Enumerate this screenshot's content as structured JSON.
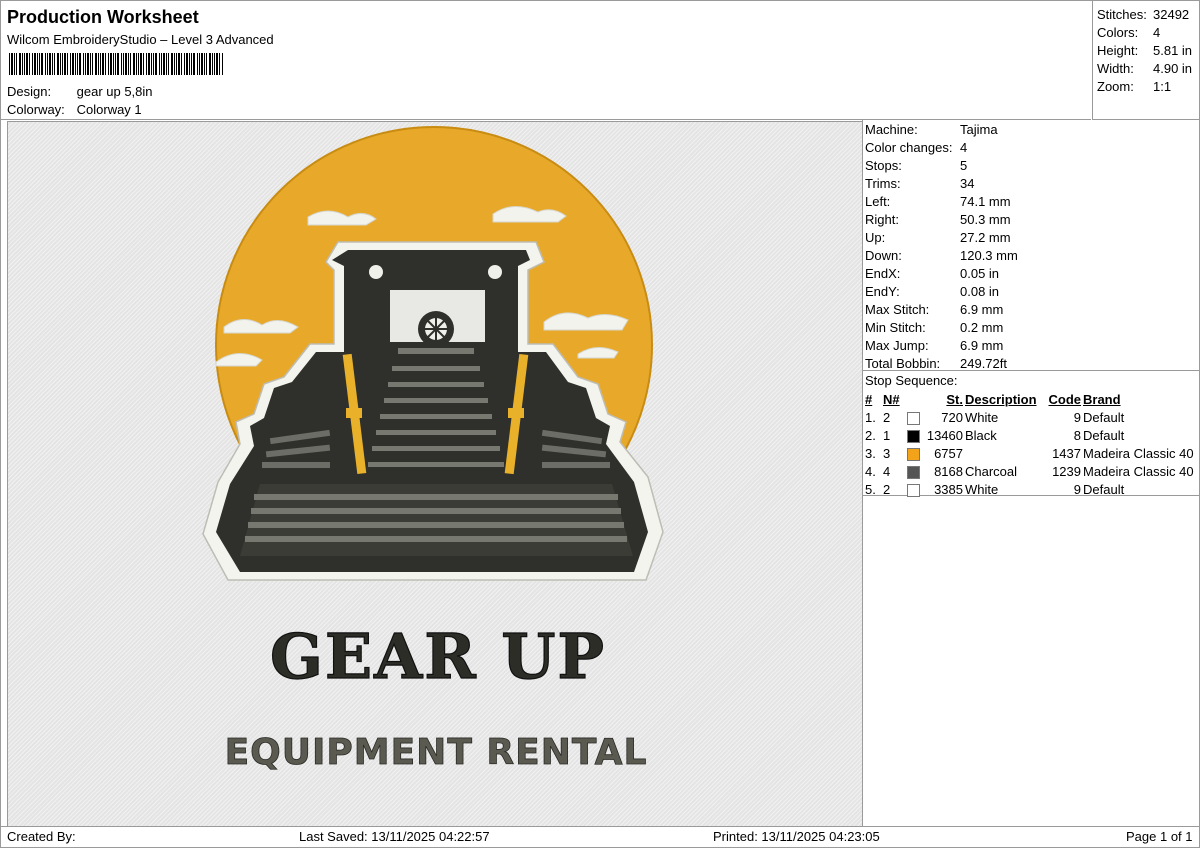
{
  "header": {
    "title": "Production Worksheet",
    "software": "Wilcom EmbroideryStudio – Level 3 Advanced",
    "design_label": "Design:",
    "design_value": "gear up 5,8in",
    "colorway_label": "Colorway:",
    "colorway_value": "Colorway 1"
  },
  "stats": [
    {
      "label": "Stitches:",
      "value": "32492"
    },
    {
      "label": "Colors:",
      "value": "4"
    },
    {
      "label": "Height:",
      "value": "5.81 in"
    },
    {
      "label": "Width:",
      "value": "4.90 in"
    },
    {
      "label": "Zoom:",
      "value": "1:1"
    }
  ],
  "machine_info": [
    {
      "label": "Machine:",
      "value": "Tajima"
    },
    {
      "label": "Color changes:",
      "value": "4"
    },
    {
      "label": "Stops:",
      "value": "5"
    },
    {
      "label": "Trims:",
      "value": "34"
    },
    {
      "label": "Left:",
      "value": "74.1 mm"
    },
    {
      "label": "Right:",
      "value": "50.3 mm"
    },
    {
      "label": "Up:",
      "value": "27.2 mm"
    },
    {
      "label": "Down:",
      "value": "120.3 mm"
    },
    {
      "label": "EndX:",
      "value": "0.05 in"
    },
    {
      "label": "EndY:",
      "value": "0.08 in"
    },
    {
      "label": "Max Stitch:",
      "value": "6.9 mm"
    },
    {
      "label": "Min Stitch:",
      "value": "0.2 mm"
    },
    {
      "label": "Max Jump:",
      "value": "6.9 mm"
    },
    {
      "label": "Total Bobbin:",
      "value": "249.72ft"
    }
  ],
  "stop_sequence": {
    "title": "Stop Sequence:",
    "headers": [
      "#",
      "N#",
      "",
      "St.",
      "Description",
      "Code",
      "Brand"
    ],
    "rows": [
      {
        "idx": "1.",
        "n": "2",
        "color": "#ffffff",
        "st": "720",
        "desc": "White",
        "code": "9",
        "brand": "Default"
      },
      {
        "idx": "2.",
        "n": "1",
        "color": "#000000",
        "st": "13460",
        "desc": "Black",
        "code": "8",
        "brand": "Default"
      },
      {
        "idx": "3.",
        "n": "3",
        "color": "#f2a31a",
        "st": "6757",
        "desc": "",
        "code": "1437",
        "brand": "Madeira Classic 40"
      },
      {
        "idx": "4.",
        "n": "4",
        "color": "#555555",
        "st": "8168",
        "desc": "Charcoal",
        "code": "1239",
        "brand": "Madeira Classic 40"
      },
      {
        "idx": "5.",
        "n": "2",
        "color": "#ffffff",
        "st": "3385",
        "desc": "White",
        "code": "9",
        "brand": "Default"
      }
    ]
  },
  "design_text": {
    "line1": "GEAR UP",
    "line2": "EQUIPMENT RENTAL"
  },
  "colors": {
    "sun": "#e8a92a",
    "machine": "#2f302b",
    "outline": "#f4f4ee",
    "accent": "#e9b12a"
  },
  "footer": {
    "created_by": "Created By:",
    "last_saved": "Last Saved: 13/11/2025 04:22:57",
    "printed": "Printed: 13/11/2025 04:23:05",
    "page": "Page 1 of 1"
  }
}
